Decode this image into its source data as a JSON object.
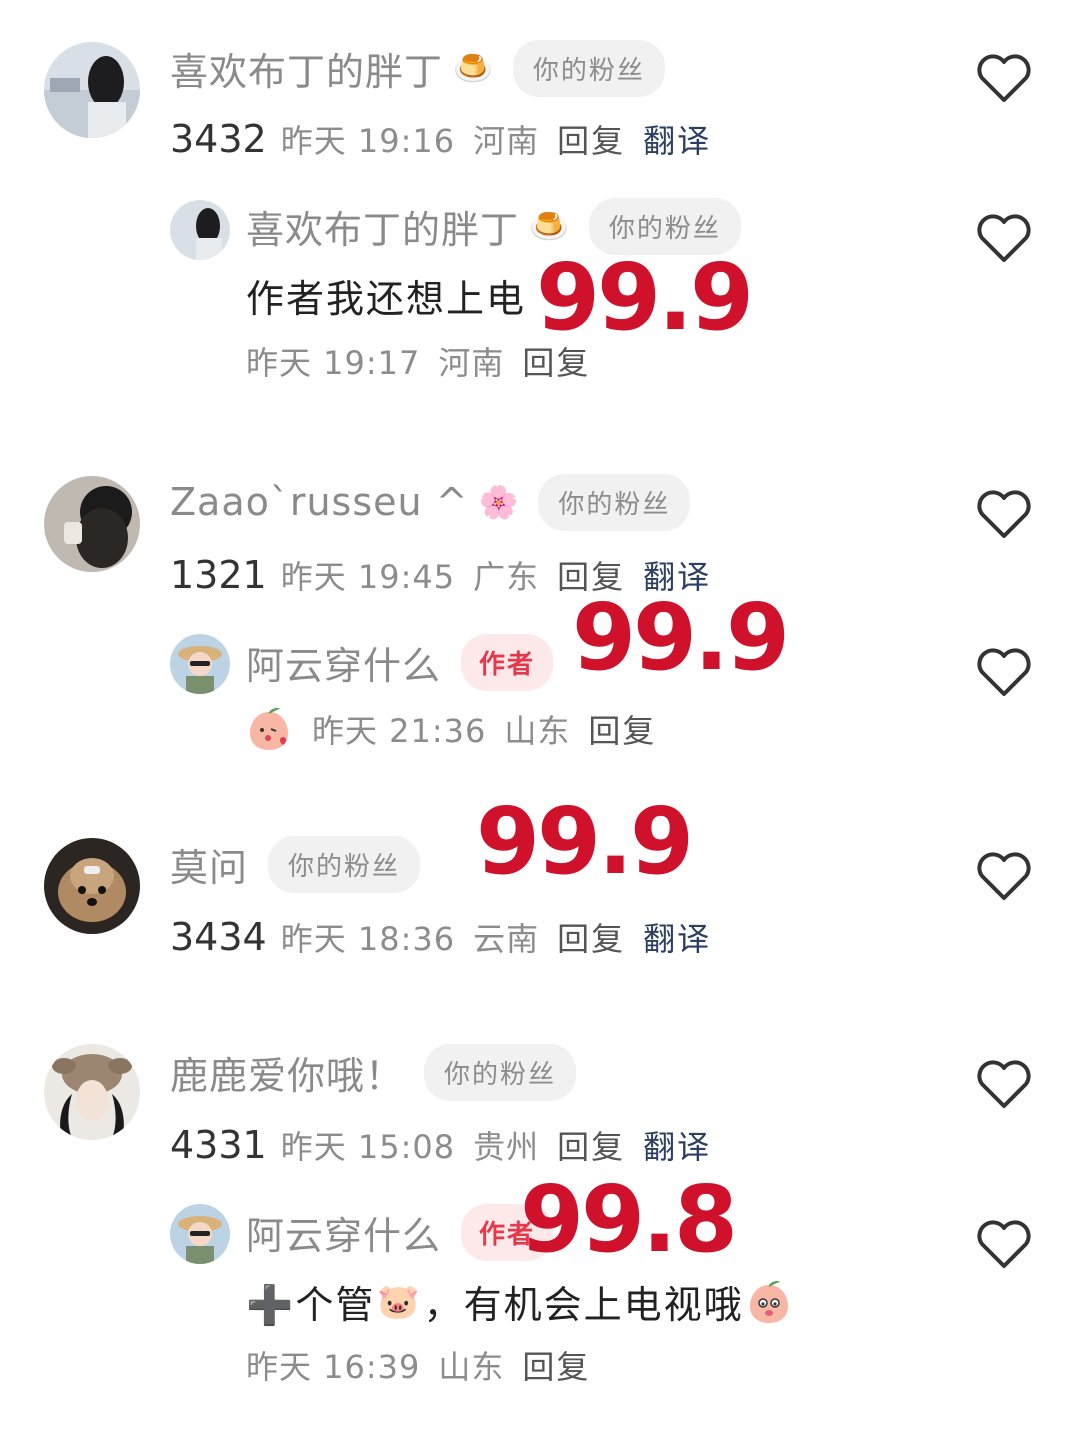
{
  "comments": [
    {
      "name": "喜欢布丁的胖丁",
      "name_emoji": "🍮",
      "badge": "你的粉丝",
      "likes": "3432",
      "time": "昨天 19:16",
      "location": "河南",
      "reply": "回复",
      "translate": "翻译",
      "sub": {
        "name": "喜欢布丁的胖丁",
        "name_emoji": "🍮",
        "badge": "你的粉丝",
        "content": "作者我还想上电",
        "time": "昨天 19:17",
        "location": "河南",
        "reply": "回复",
        "overlay": "99.9"
      }
    },
    {
      "name": "Zaao`russeu ^",
      "name_emoji": "🌸",
      "badge": "你的粉丝",
      "likes": "1321",
      "time": "昨天 19:45",
      "location": "广东",
      "reply": "回复",
      "translate": "翻译",
      "sub": {
        "name": "阿云穿什么",
        "badge": "作者",
        "time": "昨天 21:36",
        "location": "山东",
        "reply": "回复",
        "overlay": "99.9"
      }
    },
    {
      "name": "莫问",
      "badge": "你的粉丝",
      "likes": "3434",
      "time": "昨天 18:36",
      "location": "云南",
      "reply": "回复",
      "translate": "翻译",
      "overlay": "99.9"
    },
    {
      "name": "鹿鹿爱你哦！",
      "badge": "你的粉丝",
      "likes": "4331",
      "time": "昨天 15:08",
      "location": "贵州",
      "reply": "回复",
      "translate": "翻译",
      "sub": {
        "name": "阿云穿什么",
        "badge": "作者",
        "content_prefix": "➕个管",
        "content_emoji": "🐷",
        "content_text": "，有机会上电视哦",
        "time": "昨天 16:39",
        "location": "山东",
        "reply": "回复",
        "overlay": "99.8"
      }
    }
  ],
  "colors": {
    "overlay": "#d0112b",
    "translate": "#2b3f63",
    "badge_author": "#e6384a"
  },
  "icons": [
    "heart-outline-icon",
    "flan-emoji",
    "cherry-blossom-emoji",
    "peach-kiss-emoji",
    "pig-emoji",
    "peach-shy-emoji"
  ]
}
